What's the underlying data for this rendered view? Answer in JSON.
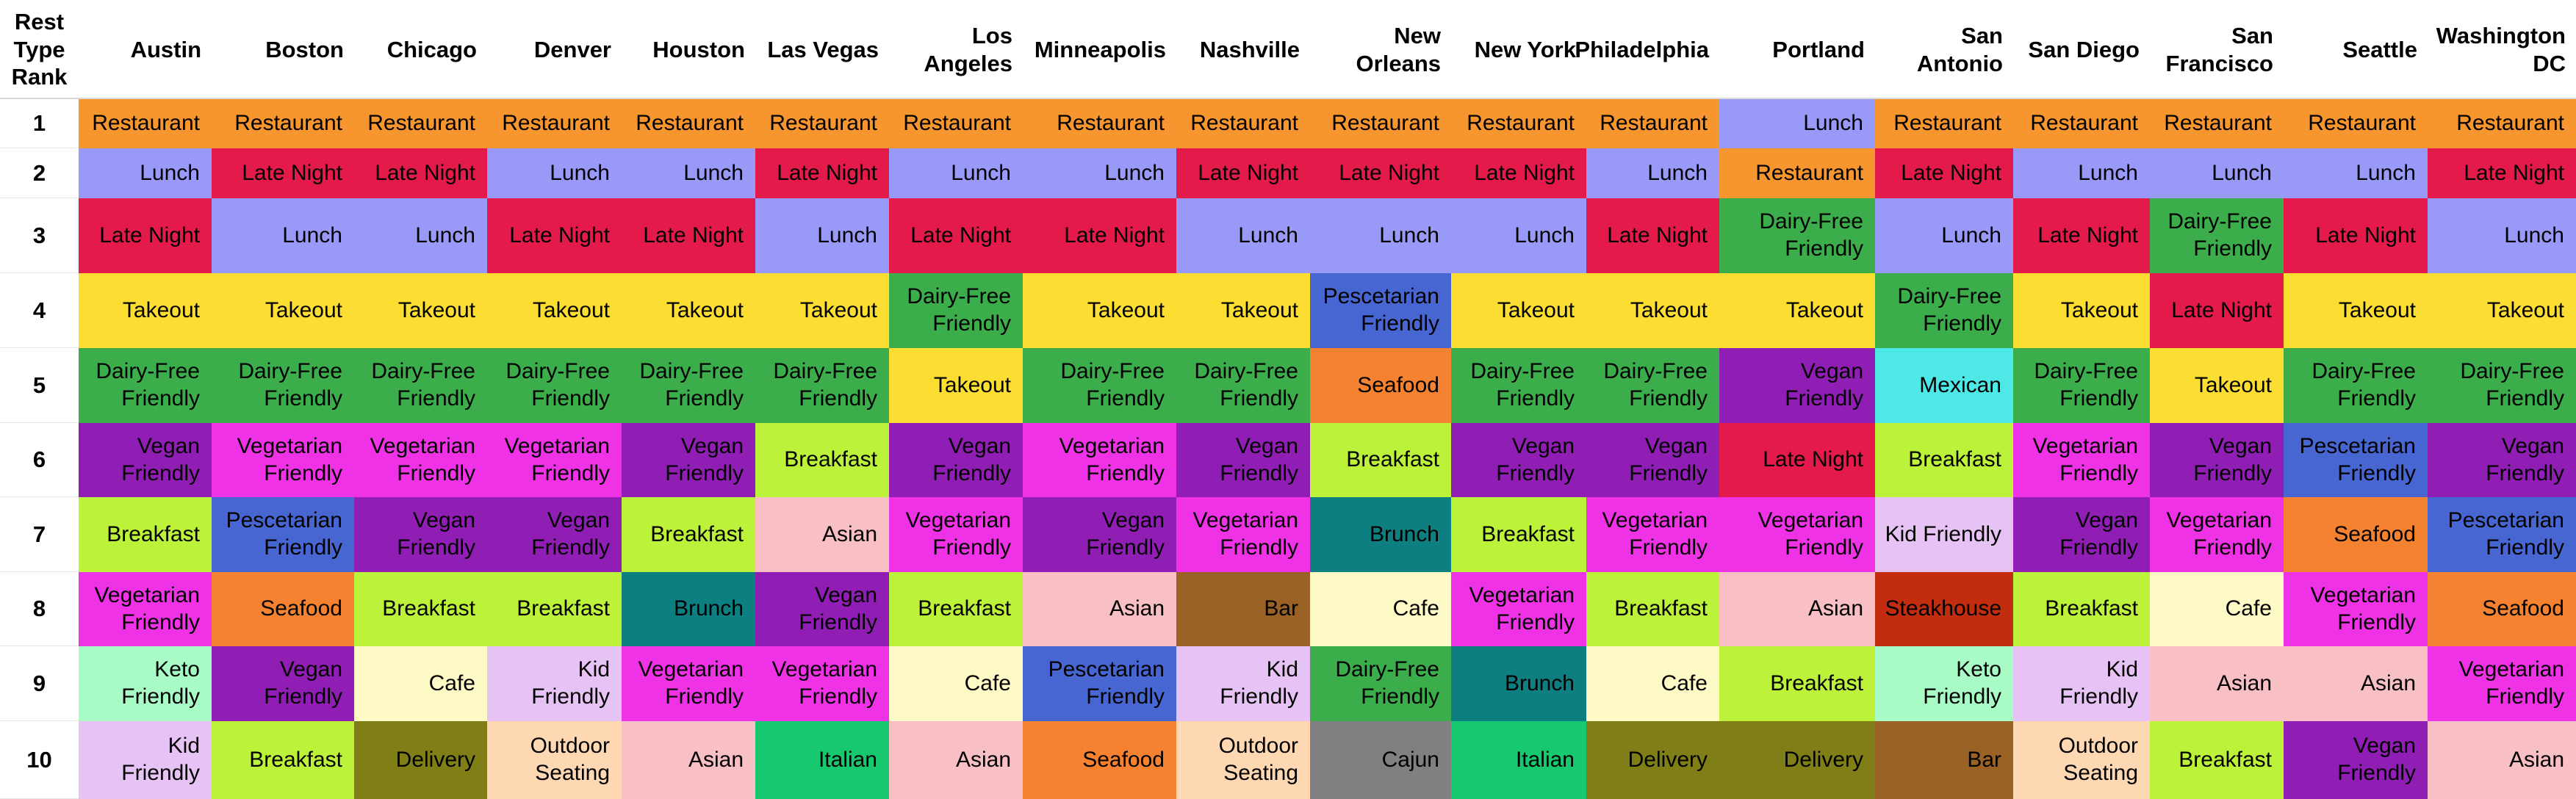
{
  "chart_data": {
    "type": "table",
    "corner_header": "Rest\nType\nRank",
    "columns": [
      "Austin",
      "Boston",
      "Chicago",
      "Denver",
      "Houston",
      "Las Vegas",
      "Los\nAngeles",
      "Minneapolis",
      "Nashville",
      "New\nOrleans",
      "New York",
      "Philadelphia",
      "Portland",
      "San\nAntonio",
      "San Diego",
      "San\nFrancisco",
      "Seattle",
      "Washington\nDC"
    ],
    "ranks": [
      "1",
      "2",
      "3",
      "4",
      "5",
      "6",
      "7",
      "8",
      "9",
      "10"
    ],
    "rows": [
      [
        "Restaurant",
        "Restaurant",
        "Restaurant",
        "Restaurant",
        "Restaurant",
        "Restaurant",
        "Restaurant",
        "Restaurant",
        "Restaurant",
        "Restaurant",
        "Restaurant",
        "Restaurant",
        "Lunch",
        "Restaurant",
        "Restaurant",
        "Restaurant",
        "Restaurant",
        "Restaurant"
      ],
      [
        "Lunch",
        "Late Night",
        "Late Night",
        "Lunch",
        "Lunch",
        "Late Night",
        "Lunch",
        "Lunch",
        "Late Night",
        "Late Night",
        "Late Night",
        "Lunch",
        "Restaurant",
        "Late Night",
        "Lunch",
        "Lunch",
        "Lunch",
        "Late Night"
      ],
      [
        "Late Night",
        "Lunch",
        "Lunch",
        "Late Night",
        "Late Night",
        "Lunch",
        "Late Night",
        "Late Night",
        "Lunch",
        "Lunch",
        "Lunch",
        "Late Night",
        "Dairy-Free\nFriendly",
        "Lunch",
        "Late Night",
        "Dairy-Free\nFriendly",
        "Late Night",
        "Lunch"
      ],
      [
        "Takeout",
        "Takeout",
        "Takeout",
        "Takeout",
        "Takeout",
        "Takeout",
        "Dairy-Free\nFriendly",
        "Takeout",
        "Takeout",
        "Pescetarian\nFriendly",
        "Takeout",
        "Takeout",
        "Takeout",
        "Dairy-Free\nFriendly",
        "Takeout",
        "Late Night",
        "Takeout",
        "Takeout"
      ],
      [
        "Dairy-Free\nFriendly",
        "Dairy-Free\nFriendly",
        "Dairy-Free\nFriendly",
        "Dairy-Free\nFriendly",
        "Dairy-Free\nFriendly",
        "Dairy-Free\nFriendly",
        "Takeout",
        "Dairy-Free\nFriendly",
        "Dairy-Free\nFriendly",
        "Seafood",
        "Dairy-Free\nFriendly",
        "Dairy-Free\nFriendly",
        "Vegan\nFriendly",
        "Mexican",
        "Dairy-Free\nFriendly",
        "Takeout",
        "Dairy-Free\nFriendly",
        "Dairy-Free\nFriendly"
      ],
      [
        "Vegan\nFriendly",
        "Vegetarian\nFriendly",
        "Vegetarian\nFriendly",
        "Vegetarian\nFriendly",
        "Vegan\nFriendly",
        "Breakfast",
        "Vegan\nFriendly",
        "Vegetarian\nFriendly",
        "Vegan\nFriendly",
        "Breakfast",
        "Vegan\nFriendly",
        "Vegan\nFriendly",
        "Late Night",
        "Breakfast",
        "Vegetarian\nFriendly",
        "Vegan\nFriendly",
        "Pescetarian\nFriendly",
        "Vegan\nFriendly"
      ],
      [
        "Breakfast",
        "Pescetarian\nFriendly",
        "Vegan\nFriendly",
        "Vegan\nFriendly",
        "Breakfast",
        "Asian",
        "Vegetarian\nFriendly",
        "Vegan\nFriendly",
        "Vegetarian\nFriendly",
        "Brunch",
        "Breakfast",
        "Vegetarian\nFriendly",
        "Vegetarian\nFriendly",
        "Kid Friendly",
        "Vegan\nFriendly",
        "Vegetarian\nFriendly",
        "Seafood",
        "Pescetarian\nFriendly"
      ],
      [
        "Vegetarian\nFriendly",
        "Seafood",
        "Breakfast",
        "Breakfast",
        "Brunch",
        "Vegan\nFriendly",
        "Breakfast",
        "Asian",
        "Bar",
        "Cafe",
        "Vegetarian\nFriendly",
        "Breakfast",
        "Asian",
        "Steakhouse",
        "Breakfast",
        "Cafe",
        "Vegetarian\nFriendly",
        "Seafood"
      ],
      [
        "Keto\nFriendly",
        "Vegan\nFriendly",
        "Cafe",
        "Kid\nFriendly",
        "Vegetarian\nFriendly",
        "Vegetarian\nFriendly",
        "Cafe",
        "Pescetarian\nFriendly",
        "Kid\nFriendly",
        "Dairy-Free\nFriendly",
        "Brunch",
        "Cafe",
        "Breakfast",
        "Keto\nFriendly",
        "Kid\nFriendly",
        "Asian",
        "Asian",
        "Vegetarian\nFriendly"
      ],
      [
        "Kid\nFriendly",
        "Breakfast",
        "Delivery",
        "Outdoor\nSeating",
        "Asian",
        "Italian",
        "Asian",
        "Seafood",
        "Outdoor\nSeating",
        "Cajun",
        "Italian",
        "Delivery",
        "Delivery",
        "Bar",
        "Outdoor\nSeating",
        "Breakfast",
        "Vegan\nFriendly",
        "Asian"
      ]
    ]
  },
  "category_colors": {
    "Restaurant": "#f7952e",
    "Lunch": "#9999f7",
    "Late Night": "#e41a4a",
    "Takeout": "#fbde31",
    "Dairy-Free\nFriendly": "#3cad4b",
    "Pescetarian\nFriendly": "#4766d1",
    "Seafood": "#f58231",
    "Vegan\nFriendly": "#911eb4",
    "Vegetarian\nFriendly": "#f032e6",
    "Mexican": "#4ee8e6",
    "Breakfast": "#bcf33a",
    "Brunch": "#0d7f80",
    "Asian": "#f8bfc4",
    "Kid Friendly": "#e6c3f4",
    "Kid\nFriendly": "#e6c3f4",
    "Steakhouse": "#c22d10",
    "Cafe": "#fefac6",
    "Bar": "#9a6325",
    "Keto\nFriendly": "#a8fbc4",
    "Delivery": "#7f7e17",
    "Outdoor\nSeating": "#fed8b3",
    "Italian": "#17c86e",
    "Cajun": "#808080"
  }
}
